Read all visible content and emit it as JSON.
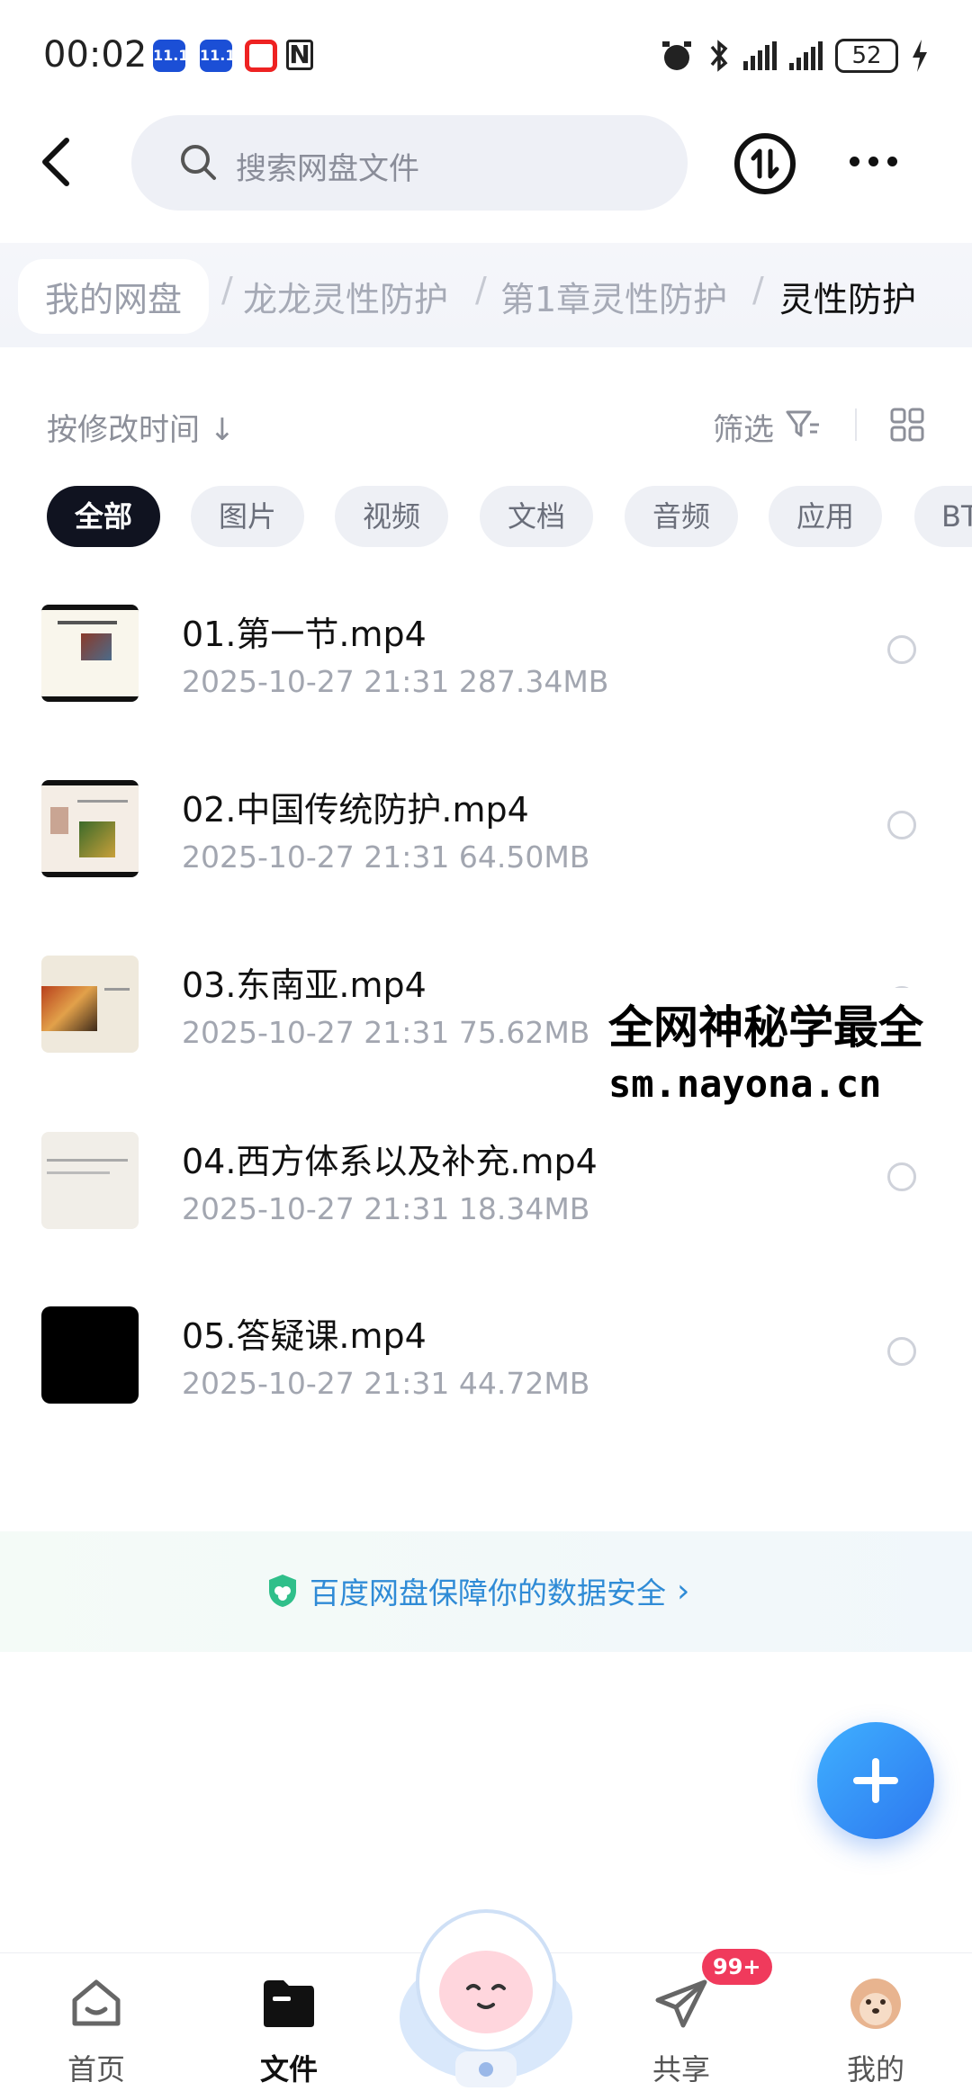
{
  "status_bar": {
    "time": "00:02",
    "battery": "52"
  },
  "header": {
    "search_placeholder": "搜索网盘文件"
  },
  "breadcrumb": {
    "items": [
      "我的网盘",
      "龙龙灵性防护",
      "第1章灵性防护",
      "灵性防护"
    ]
  },
  "toolbar": {
    "sort_label": "按修改时间 ↓",
    "filter_label": "筛选"
  },
  "filter_chips": [
    "全部",
    "图片",
    "视频",
    "文档",
    "音频",
    "应用",
    "BT"
  ],
  "files": [
    {
      "name": "01.第一节.mp4",
      "meta": "2025-10-27  21:31   287.34MB"
    },
    {
      "name": "02.中国传统防护.mp4",
      "meta": "2025-10-27  21:31   64.50MB"
    },
    {
      "name": "03.东南亚.mp4",
      "meta": "2025-10-27  21:31   75.62MB"
    },
    {
      "name": "04.西方体系以及补充.mp4",
      "meta": "2025-10-27  21:31   18.34MB"
    },
    {
      "name": "05.答疑课.mp4",
      "meta": "2025-10-27  21:31   44.72MB"
    }
  ],
  "watermark": {
    "line1": "全网神秘学最全",
    "line2": "sm.nayona.cn"
  },
  "security_banner": "百度网盘保障你的数据安全",
  "bottom_nav": {
    "home": "首页",
    "files": "文件",
    "share": "共享",
    "me": "我的",
    "share_badge": "99+"
  },
  "colors": {
    "accent": "#2d77ef",
    "badge": "#f03a5c",
    "active_chip": "#101320"
  }
}
